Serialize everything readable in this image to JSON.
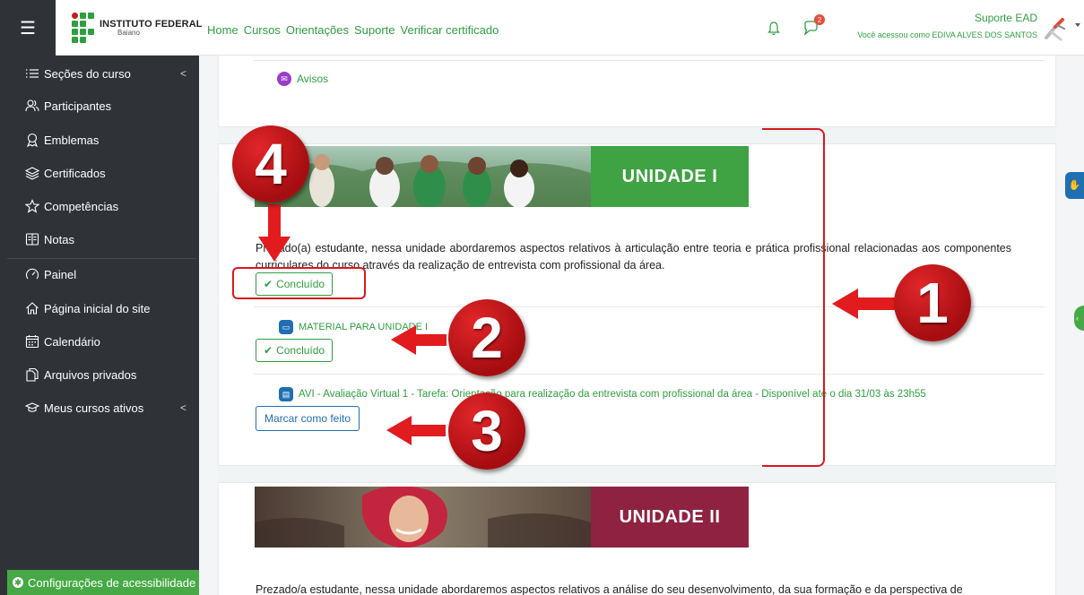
{
  "navbar": {
    "logo_title": "INSTITUTO FEDERAL",
    "logo_subtitle": "Baiano",
    "links": [
      "Home",
      "Cursos",
      "Orientações",
      "Suporte",
      "Verificar certificado"
    ],
    "chat_badge": "2",
    "user_name": "Suporte EAD",
    "logged_as": "Você acessou como EDIVA ALVES DOS SANTOS"
  },
  "sidebar": {
    "items": [
      {
        "label": "Seções do curso",
        "icon": "list-icon"
      },
      {
        "label": "Participantes",
        "icon": "users-icon"
      },
      {
        "label": "Emblemas",
        "icon": "badge-icon"
      },
      {
        "label": "Certificados",
        "icon": "layers-icon"
      },
      {
        "label": "Competências",
        "icon": "star-icon"
      },
      {
        "label": "Notas",
        "icon": "table-icon"
      },
      {
        "label": "Painel",
        "icon": "dashboard-icon"
      },
      {
        "label": "Página inicial do site",
        "icon": "home-icon"
      },
      {
        "label": "Calendário",
        "icon": "calendar-icon"
      },
      {
        "label": "Arquivos privados",
        "icon": "files-icon"
      },
      {
        "label": "Meus cursos ativos",
        "icon": "graduation-cap-icon"
      }
    ],
    "accessibility": "Configurações de acessibilidade"
  },
  "main": {
    "avisos": "Avisos",
    "unit1": {
      "banner": "UNIDADE I",
      "summary": "Prezado(a) estudante, nessa unidade abordaremos aspectos relativos à articulação entre teoria e prática profissional relacionadas aos componentes curriculares do curso através da realização de entrevista com profissional da área.",
      "done_label": "Concluído",
      "material": "MATERIAL PARA UNIDADE I",
      "material_done": "Concluído",
      "avi": "AVI - Avaliação Virtual 1 - Tarefa: Orientação para realização da entrevista com profissional da área - Disponível até o dia 31/03 às 23h55",
      "mark_done": "Marcar como feito"
    },
    "unit2": {
      "banner": "UNIDADE II",
      "summary": "Prezado/a estudante, nessa unidade abordaremos aspectos relativos a análise do seu desenvolvimento, da sua formação e da perspectiva de"
    }
  },
  "annotations": {
    "markers": [
      "1",
      "2",
      "3",
      "4"
    ]
  },
  "colors": {
    "brand_green": "#2f9e41",
    "sidebar_bg": "#2f3338",
    "annotation_red": "#d7191d",
    "unit2_label_bg": "#8e2240"
  }
}
